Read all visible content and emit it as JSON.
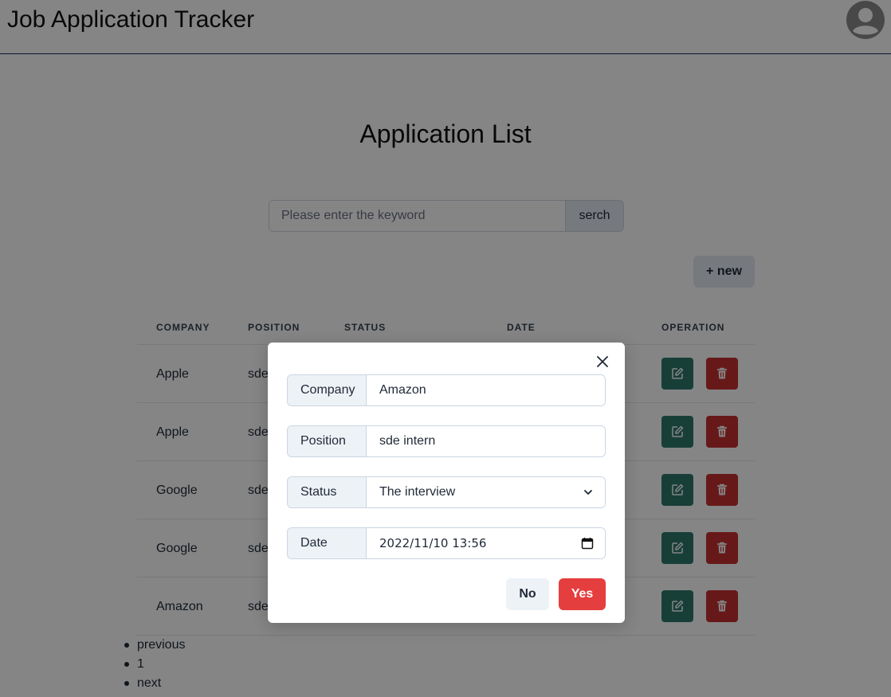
{
  "header": {
    "title": "Job Application Tracker",
    "avatar_icon": "user-circle-icon"
  },
  "main": {
    "title": "Application List",
    "search": {
      "placeholder": "Please enter the keyword",
      "button_label": "serch"
    },
    "new_button_label": "+ new"
  },
  "table": {
    "columns": [
      "COMPANY",
      "POSITION",
      "STATUS",
      "DATE",
      "OPERATION"
    ],
    "rows": [
      {
        "company": "Apple",
        "position": "sde"
      },
      {
        "company": "Apple",
        "position": "sde"
      },
      {
        "company": "Google",
        "position": "sde"
      },
      {
        "company": "Google",
        "position": "sde"
      },
      {
        "company": "Amazon",
        "position": "sde"
      }
    ],
    "edit_icon": "edit-icon",
    "delete_icon": "trash-icon",
    "colors": {
      "edit": "#2c7a6b",
      "delete": "#c53030"
    }
  },
  "pagination": [
    "previous",
    "1",
    "next"
  ],
  "modal": {
    "close_icon": "close-icon",
    "fields": {
      "company": {
        "label": "Company",
        "value": "Amazon"
      },
      "position": {
        "label": "Position",
        "value": "sde intern"
      },
      "status": {
        "label": "Status",
        "value": "The interview"
      },
      "date": {
        "label": "Date",
        "value": "2022/11/10 13:56"
      }
    },
    "no_label": "No",
    "yes_label": "Yes",
    "colors": {
      "yes": "#e53e3e"
    }
  }
}
